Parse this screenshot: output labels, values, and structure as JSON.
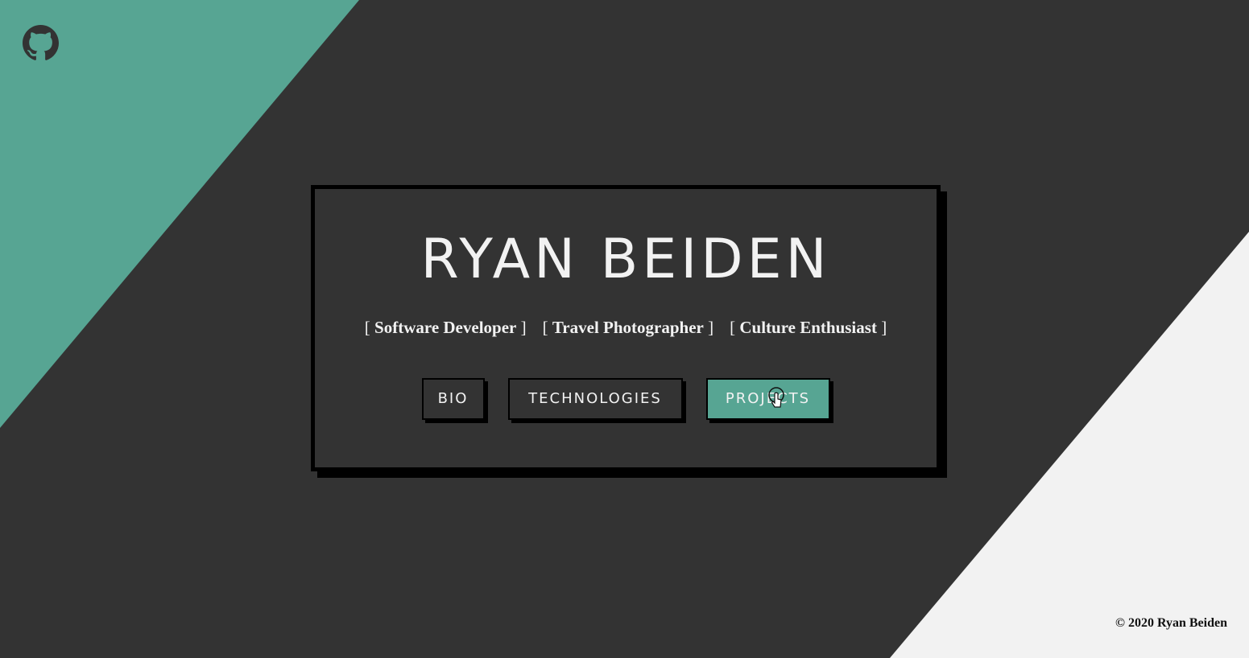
{
  "colors": {
    "background": "#333333",
    "accent": "#57a593",
    "light": "#f2f2f2",
    "shadow": "#000000"
  },
  "header": {
    "github_icon": "github-icon"
  },
  "hero": {
    "title": "RYAN BEIDEN",
    "roles": [
      {
        "open": "[",
        "name": "Software Developer",
        "close": "]"
      },
      {
        "open": "[",
        "name": "Travel Photographer",
        "close": "]"
      },
      {
        "open": "[",
        "name": "Culture Enthusiast",
        "close": "]"
      }
    ]
  },
  "nav": {
    "buttons": [
      {
        "label": "BIO",
        "active": false
      },
      {
        "label": "TECHNOLOGIES",
        "active": false
      },
      {
        "label": "PROJECTS",
        "active": true
      }
    ]
  },
  "footer": {
    "copyright": "© 2020 Ryan Beiden"
  }
}
